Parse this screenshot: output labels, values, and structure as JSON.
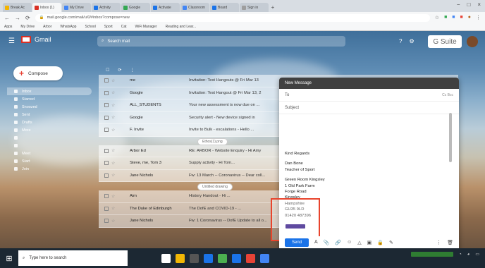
{
  "browser": {
    "tabs": [
      {
        "label": "Break Ac",
        "color": "#f4b400"
      },
      {
        "label": "Inbox (1)",
        "color": "#d93025",
        "active": true
      },
      {
        "label": "My Drive",
        "color": "#4285f4"
      },
      {
        "label": "Activity",
        "color": "#1a73e8"
      },
      {
        "label": "Google",
        "color": "#34a853"
      },
      {
        "label": "Activate",
        "color": "#1a73e8"
      },
      {
        "label": "Classroom",
        "color": "#4285f4"
      },
      {
        "label": "Board",
        "color": "#1a73e8"
      },
      {
        "label": "Sign in",
        "color": "#9e9e9e"
      }
    ],
    "url": "mail.google.com/mail/u/0/#inbox?compose=new",
    "bookmarks": [
      "Apps",
      "My Drive",
      "Arbor",
      "WhatsApp",
      "School",
      "Sport",
      "Cat",
      "WiFi Manager",
      "Reading and Lear..."
    ]
  },
  "gmail": {
    "app_name": "Gmail",
    "search_placeholder": "Search mail",
    "gsuite": "G Suite",
    "compose_label": "Compose",
    "sidebar": [
      "Inbox",
      "Starred",
      "Snoozed",
      "Sent",
      "Drafts",
      "More",
      "",
      "",
      "Meet",
      "Start",
      "Join"
    ],
    "emails": [
      {
        "sender": "me",
        "subject": "Invitation: Test Hangouts @ Fri Mar 13"
      },
      {
        "sender": "Google",
        "subject": "Invitation: Test Hangout @ Fri Mar 13, 2"
      },
      {
        "sender": "ALL_STUDENTS",
        "subject": "Your new assessment is now due on ..."
      },
      {
        "sender": "Google",
        "subject": "Security alert - New device signed in"
      },
      {
        "sender": "F. Invite",
        "subject": "Invite to Bulk - escalations - Hello ..."
      },
      {
        "sender": "Arbor Ed",
        "subject": "RE: ARBOR - Website Enquiry - Hi Amy"
      },
      {
        "sender": "Steve, me, Tom 3",
        "subject": "Supply activity - Hi Tom..."
      },
      {
        "sender": "Jane Nichols",
        "subject": "Fw: 13 March -- Coronavirus -- Dear coll..."
      },
      {
        "sender": "Aim",
        "subject": "History Handout - Hi ..."
      },
      {
        "sender": "The Duke of Edinburgh",
        "subject": "The DofE and COVID-19 - ..."
      },
      {
        "sender": "Jane Nichols",
        "subject": "Fw: 1 Coronavirus -- DofE Update to all o..."
      }
    ],
    "chip_label": "Ethos(1).png",
    "chip2_label": "Untitled drawing"
  },
  "compose_window": {
    "title": "New Message",
    "to_label": "To",
    "cc_label": "Cc Bcc",
    "subject_label": "Subject",
    "body": [
      "Kind Regards",
      "",
      "Dan Bone",
      "Teacher of Sport",
      "",
      "Green Room Kingsley",
      "1 Old Park Farm",
      "Forge Road",
      "Kingsley",
      "Hampshire",
      "GU35 9LD",
      "01420 487396"
    ],
    "send_label": "Send"
  },
  "taskbar": {
    "search_placeholder": "Type here to search",
    "app_colors": [
      "#fff",
      "#f2b705",
      "#555",
      "#1a73e8",
      "#4caf50",
      "#1a73e8",
      "#e84336",
      "#4285f4"
    ]
  }
}
